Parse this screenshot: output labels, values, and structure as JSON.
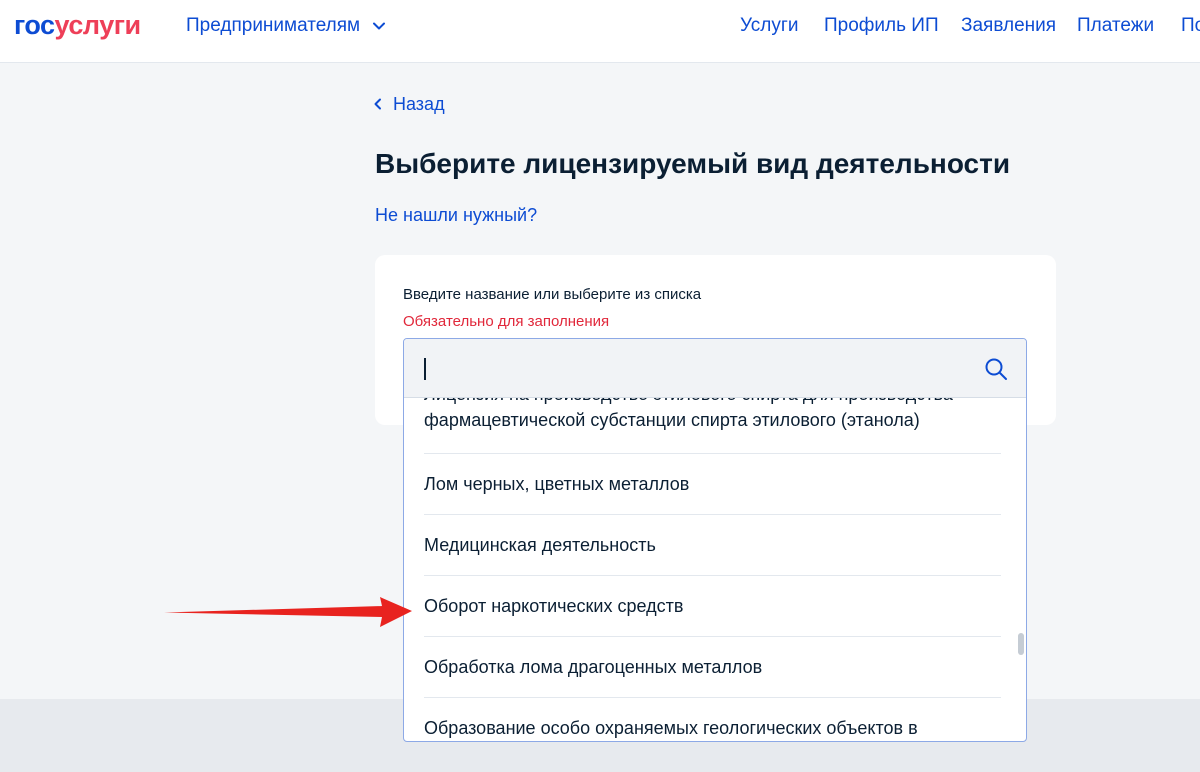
{
  "header": {
    "logo_part1": "гос",
    "logo_part2": "услуги",
    "audience_label": "Предпринимателям",
    "nav": [
      {
        "label": "Услуги"
      },
      {
        "label": "Профиль ИП"
      },
      {
        "label": "Заявления"
      },
      {
        "label": "Платежи"
      },
      {
        "label": "По"
      }
    ]
  },
  "main": {
    "back_label": "Назад",
    "title": "Выберите лицензируемый вид деятельности",
    "not_found_link": "Не нашли нужный?",
    "field": {
      "label": "Введите название или выберите из списка",
      "required_text": "Обязательно для заполнения",
      "input_value": "",
      "options": [
        {
          "label": "Лицензия на производство этилового спирта для производства фармацевтической субстанции спирта этилового (этанола)"
        },
        {
          "label": "Лом черных, цветных металлов"
        },
        {
          "label": "Медицинская деятельность"
        },
        {
          "label": "Оборот наркотических средств"
        },
        {
          "label": "Обработка лома драгоценных металлов"
        },
        {
          "label": "Образование особо охраняемых геологических объектов в"
        }
      ]
    }
  },
  "colors": {
    "brand_blue": "#0d4cd3",
    "brand_red": "#ee3f58",
    "error_red": "#e1283b",
    "annotation_arrow": "#e8231f"
  },
  "icons": {
    "audience_chevron": "chevron-down-icon",
    "back": "chevron-left-icon",
    "search": "search-icon",
    "annotation": "red-arrow-icon"
  }
}
